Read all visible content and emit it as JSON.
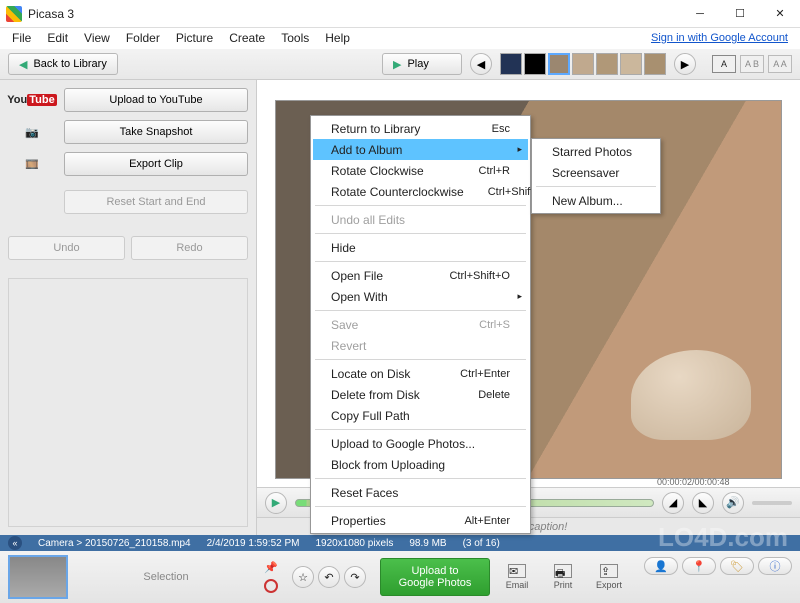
{
  "window": {
    "title": "Picasa 3"
  },
  "menu": {
    "items": [
      "File",
      "Edit",
      "View",
      "Folder",
      "Picture",
      "Create",
      "Tools",
      "Help"
    ],
    "signin": "Sign in with Google Account"
  },
  "toolbar": {
    "back": "Back to Library",
    "play": "Play",
    "ablabels": [
      "A",
      "A B",
      "A A"
    ]
  },
  "sidebar": {
    "youtube": "Upload to YouTube",
    "snapshot": "Take Snapshot",
    "export": "Export Clip",
    "reset": "Reset Start and End",
    "undo": "Undo",
    "redo": "Redo"
  },
  "player": {
    "timecode": "00:00:02/00:00:48"
  },
  "caption": {
    "placeholder": "Make a caption!"
  },
  "info": {
    "folder": "Camera > 20150726_210158.mp4",
    "date": "2/4/2019 1:59:52 PM",
    "dims": "1920x1080 pixels",
    "size": "98.9 MB",
    "index": "(3 of 16)"
  },
  "bottom": {
    "selection": "Selection",
    "upload": "Upload to Google Photos",
    "email": "Email",
    "print": "Print",
    "export": "Export"
  },
  "ctx": {
    "items": [
      {
        "label": "Return to Library",
        "shortcut": "Esc"
      },
      {
        "label": "Add to Album",
        "sub": true,
        "hi": true
      },
      {
        "label": "Rotate Clockwise",
        "shortcut": "Ctrl+R"
      },
      {
        "label": "Rotate Counterclockwise",
        "shortcut": "Ctrl+Shift+R"
      },
      {
        "sep": true
      },
      {
        "label": "Undo all Edits",
        "disabled": true
      },
      {
        "sep": true
      },
      {
        "label": "Hide"
      },
      {
        "sep": true
      },
      {
        "label": "Open File",
        "shortcut": "Ctrl+Shift+O"
      },
      {
        "label": "Open With",
        "sub": true
      },
      {
        "sep": true
      },
      {
        "label": "Save",
        "shortcut": "Ctrl+S",
        "disabled": true
      },
      {
        "label": "Revert",
        "disabled": true
      },
      {
        "sep": true
      },
      {
        "label": "Locate on Disk",
        "shortcut": "Ctrl+Enter"
      },
      {
        "label": "Delete from Disk",
        "shortcut": "Delete"
      },
      {
        "label": "Copy Full Path"
      },
      {
        "sep": true
      },
      {
        "label": "Upload to Google Photos..."
      },
      {
        "label": "Block from Uploading"
      },
      {
        "sep": true
      },
      {
        "label": "Reset Faces"
      },
      {
        "sep": true
      },
      {
        "label": "Properties",
        "shortcut": "Alt+Enter"
      }
    ],
    "sub": [
      "Starred Photos",
      "Screensaver",
      "",
      "New Album..."
    ]
  },
  "watermark": "LO4D.com"
}
